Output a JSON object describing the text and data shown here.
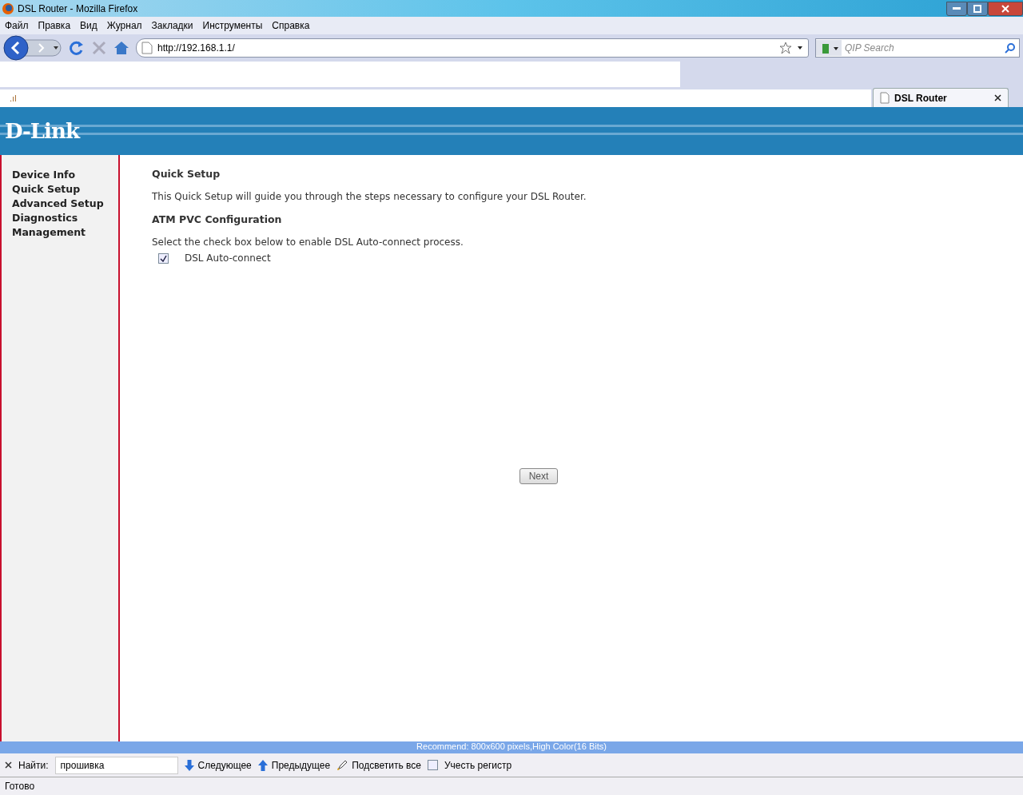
{
  "window": {
    "title": "DSL Router - Mozilla Firefox"
  },
  "menu": [
    "Файл",
    "Правка",
    "Вид",
    "Журнал",
    "Закладки",
    "Инструменты",
    "Справка"
  ],
  "address": {
    "value": "http://192.168.1.1/"
  },
  "search": {
    "placeholder": "QIP Search"
  },
  "tab_strip": {
    "partial_tab_text": ".ıl"
  },
  "tabs": [
    {
      "label": "DSL Router",
      "selected": true
    }
  ],
  "header": {
    "logo": "D-Link"
  },
  "sidebar": {
    "items": [
      {
        "label": "Device Info"
      },
      {
        "label": "Quick Setup"
      },
      {
        "label": "Advanced Setup"
      },
      {
        "label": "Diagnostics"
      },
      {
        "label": "Management"
      }
    ]
  },
  "content": {
    "title": "Quick Setup",
    "intro": "This Quick Setup will guide you through the steps necessary to configure your DSL Router.",
    "section": "ATM PVC Configuration",
    "instruction": "Select the check box below to enable DSL Auto-connect process.",
    "checkbox": {
      "label": "DSL Auto-connect",
      "checked": true
    },
    "button": "Next"
  },
  "footer": {
    "text": "Recommend: 800x600 pixels,High Color(16 Bits)"
  },
  "find_bar": {
    "label": "Найти:",
    "value": "прошивка",
    "next": "Следующее",
    "previous": "Предыдущее",
    "highlight": "Подсветить все",
    "match_case": {
      "label": "Учесть регистр",
      "checked": false
    }
  },
  "status_bar": {
    "text": "Готово"
  }
}
